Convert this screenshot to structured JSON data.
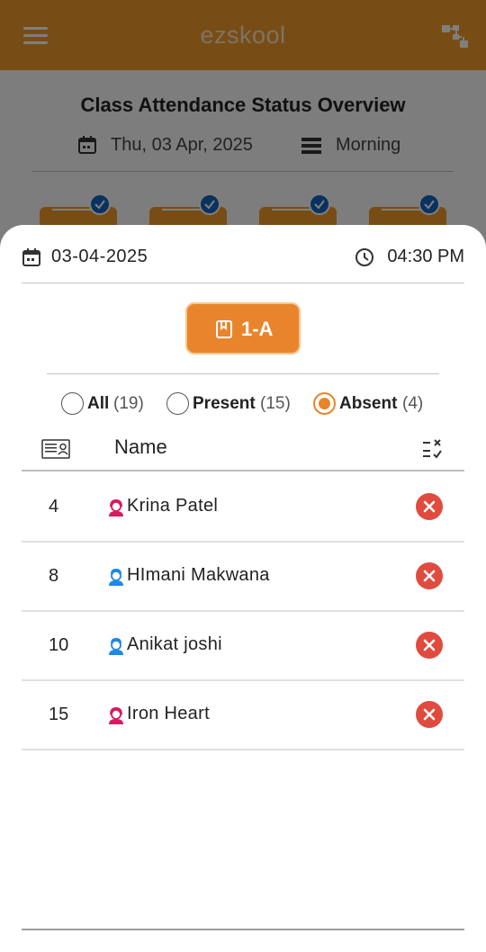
{
  "app": {
    "title": "ezskool",
    "brand_color": "#f19a2b"
  },
  "background": {
    "page_title": "Class Attendance Status Overview",
    "date": "Thu, 03 Apr, 2025",
    "shift": "Morning"
  },
  "sheet": {
    "date": "03-04-2025",
    "time": "04:30 PM",
    "class_label": "1-A",
    "filters": [
      {
        "label": "All",
        "count": "(19)",
        "selected": false
      },
      {
        "label": "Present",
        "count": "(15)",
        "selected": false
      },
      {
        "label": "Absent",
        "count": "(4)",
        "selected": true
      }
    ],
    "table": {
      "name_header": "Name",
      "rows": [
        {
          "roll": "4",
          "name": "Krina Patel",
          "gender": "female",
          "status": "absent"
        },
        {
          "roll": "8",
          "name": "HImani Makwana",
          "gender": "male",
          "status": "absent"
        },
        {
          "roll": "10",
          "name": "Anikat joshi",
          "gender": "male",
          "status": "absent"
        },
        {
          "roll": "15",
          "name": "Iron Heart",
          "gender": "female",
          "status": "absent"
        }
      ]
    }
  }
}
